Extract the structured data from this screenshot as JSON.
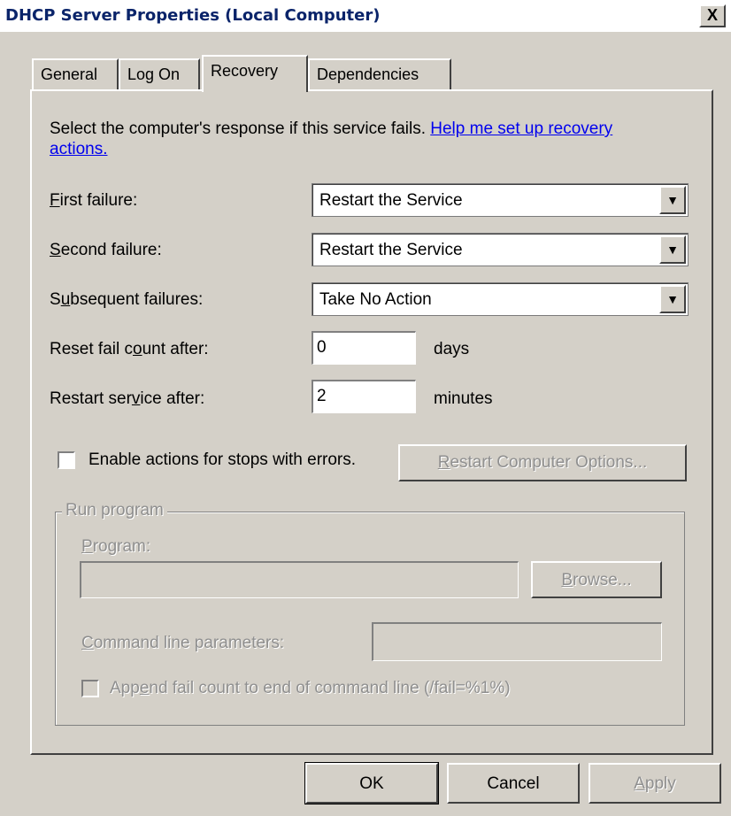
{
  "window": {
    "title": "DHCP Server Properties (Local Computer)",
    "close_glyph": "X"
  },
  "tabs": [
    {
      "label": "General",
      "active": false
    },
    {
      "label": "Log On",
      "active": false
    },
    {
      "label": "Recovery",
      "active": true
    },
    {
      "label": "Dependencies",
      "active": false
    }
  ],
  "recovery": {
    "intro_text": "Select the computer's response if this service fails.",
    "help_link_part1": "Help me set up recovery",
    "help_link_part2": "actions.",
    "first_failure": {
      "label_key": "F",
      "label_rest": "irst failure:",
      "value": "Restart the Service"
    },
    "second_failure": {
      "label_key": "S",
      "label_rest": "econd failure:",
      "value": "Restart the Service"
    },
    "subsequent_failures": {
      "label_pre": "S",
      "label_key": "u",
      "label_rest": "bsequent failures:",
      "value": "Take No Action"
    },
    "reset_fail_count": {
      "label_pre": "Reset fail c",
      "label_key": "o",
      "label_rest": "unt after:",
      "value": "0",
      "unit": "days"
    },
    "restart_service": {
      "label_pre": "Restart ser",
      "label_key": "v",
      "label_rest": "ice after:",
      "value": "2",
      "unit": "minutes"
    },
    "enable_actions_label": "Enable actions for stops with errors.",
    "enable_actions_checked": false,
    "restart_computer_options": {
      "key": "R",
      "rest": "estart Computer Options..."
    }
  },
  "run_program": {
    "group_title": "Run program",
    "program_label_key": "P",
    "program_label_rest": "rogram:",
    "program_value": "",
    "browse_key": "B",
    "browse_rest": "rowse...",
    "cmd_label_key": "C",
    "cmd_label_rest": "ommand line parameters:",
    "cmd_value": "",
    "append_pre": "App",
    "append_key": "e",
    "append_rest": "nd fail count to end of command line (/fail=%1%)"
  },
  "footer": {
    "ok": "OK",
    "cancel": "Cancel",
    "apply_key": "A",
    "apply_rest": "pply"
  },
  "colors": {
    "title_text": "#0a246a",
    "dialog_bg": "#d4d0c8",
    "link": "#0000ee",
    "disabled_text": "#8f8f8f"
  }
}
